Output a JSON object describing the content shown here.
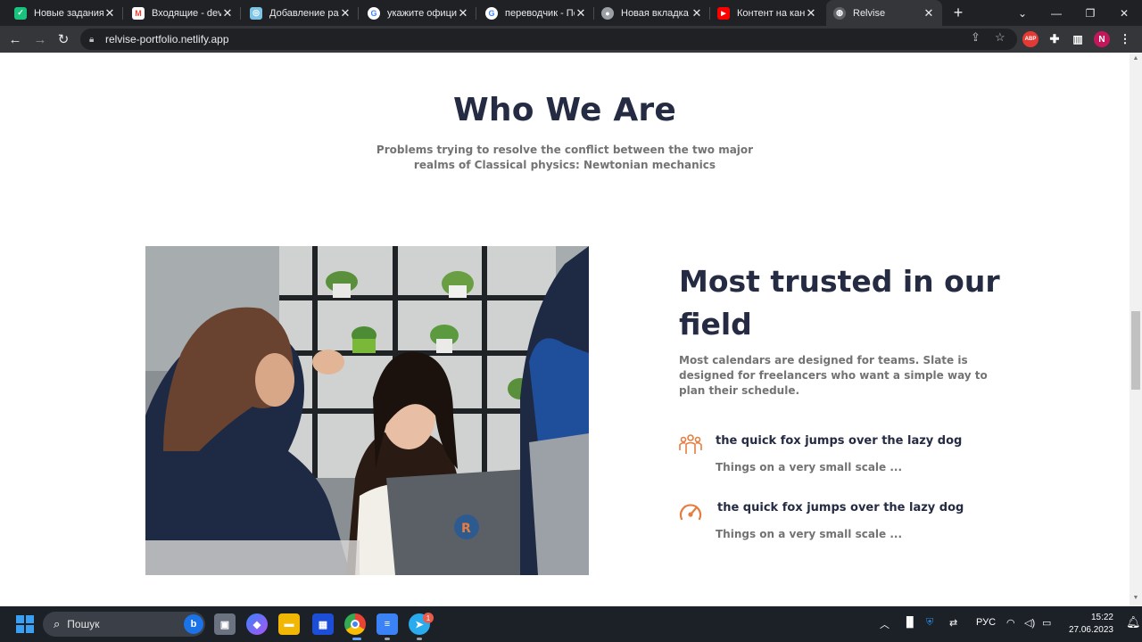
{
  "browser": {
    "tabs": [
      {
        "title": "Новые задания",
        "icon": "check-icon",
        "color": "#19c37d"
      },
      {
        "title": "Входящие - devel",
        "icon": "gmail-icon",
        "color": "#ea4335"
      },
      {
        "title": "Добавление раб",
        "icon": "app-icon",
        "color": "#7bc4e6"
      },
      {
        "title": "укажите официа",
        "icon": "google-icon",
        "color": "#4285f4"
      },
      {
        "title": "переводчик - По",
        "icon": "google-icon",
        "color": "#4285f4"
      },
      {
        "title": "Новая вкладка",
        "icon": "chrome-icon",
        "color": "#9aa0a6"
      },
      {
        "title": "Контент на канал",
        "icon": "youtube-icon",
        "color": "#ff0000"
      },
      {
        "title": "Relvise",
        "icon": "globe-icon",
        "color": "#9aa0a6"
      }
    ],
    "active_tab_index": 7,
    "url": "relvise-portfolio.netlify.app",
    "profile_initial": "N",
    "adblock_label": "ABP"
  },
  "page": {
    "section_title": "Who We Are",
    "section_subtitle": "Problems trying to resolve the conflict between the two major realms of Classical physics: Newtonian mechanics",
    "trust_title": "Most trusted in our field",
    "trust_description": "Most calendars are designed for teams. Slate is designed for freelancers who want a simple way to plan their schedule.",
    "features": [
      {
        "title": "the quick fox jumps over the lazy dog",
        "subtitle": "Things on a very small scale ...",
        "icon": "team-icon"
      },
      {
        "title": "the quick fox jumps over the lazy dog",
        "subtitle": "Things on a very small scale ...",
        "icon": "speedometer-icon"
      }
    ],
    "accent_color": "#e77c40",
    "heading_color": "#252b42",
    "text_color": "#737373"
  },
  "taskbar": {
    "search_placeholder": "Пошук",
    "language": "РУС",
    "time": "15:22",
    "date": "27.06.2023",
    "telegram_badge": "1"
  }
}
